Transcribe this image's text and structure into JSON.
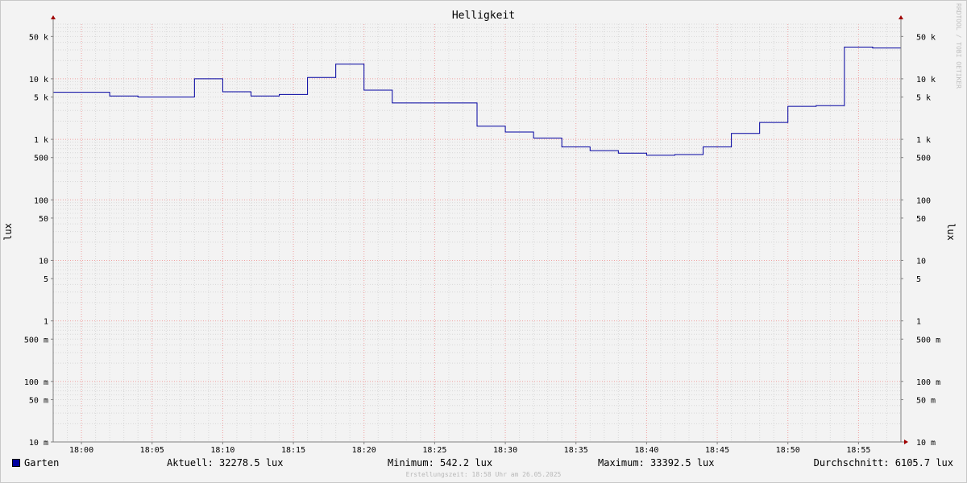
{
  "chart_data": {
    "type": "line",
    "title": "Helligkeit",
    "ylabel": "lux",
    "yscale": "log",
    "ylim": [
      0.01,
      80000
    ],
    "xlim": [
      "17:58",
      "18:58"
    ],
    "grid": true,
    "y_ticks": [
      {
        "value": 50000,
        "label": "50 k"
      },
      {
        "value": 10000,
        "label": "10 k"
      },
      {
        "value": 5000,
        "label": "5 k"
      },
      {
        "value": 1000,
        "label": "1 k"
      },
      {
        "value": 500,
        "label": "500"
      },
      {
        "value": 100,
        "label": "100"
      },
      {
        "value": 50,
        "label": "50"
      },
      {
        "value": 10,
        "label": "10"
      },
      {
        "value": 5,
        "label": "5"
      },
      {
        "value": 1,
        "label": "1"
      },
      {
        "value": 0.5,
        "label": "500 m"
      },
      {
        "value": 0.1,
        "label": "100 m"
      },
      {
        "value": 0.05,
        "label": "50 m"
      },
      {
        "value": 0.01,
        "label": "10 m"
      }
    ],
    "x_ticks": [
      "18:00",
      "18:05",
      "18:10",
      "18:15",
      "18:20",
      "18:25",
      "18:30",
      "18:35",
      "18:40",
      "18:45",
      "18:50",
      "18:55"
    ],
    "series": [
      {
        "name": "Garten",
        "color": "#0000a0",
        "step": true,
        "points": [
          {
            "x": "17:58",
            "y": 6000
          },
          {
            "x": "18:02",
            "y": 5200
          },
          {
            "x": "18:04",
            "y": 5000
          },
          {
            "x": "18:08",
            "y": 10000
          },
          {
            "x": "18:10",
            "y": 6100
          },
          {
            "x": "18:12",
            "y": 5200
          },
          {
            "x": "18:14",
            "y": 5500
          },
          {
            "x": "18:16",
            "y": 10500
          },
          {
            "x": "18:18",
            "y": 17500
          },
          {
            "x": "18:20",
            "y": 6500
          },
          {
            "x": "18:22",
            "y": 4000
          },
          {
            "x": "18:28",
            "y": 1650
          },
          {
            "x": "18:30",
            "y": 1320
          },
          {
            "x": "18:32",
            "y": 1050
          },
          {
            "x": "18:34",
            "y": 750
          },
          {
            "x": "18:36",
            "y": 650
          },
          {
            "x": "18:38",
            "y": 590
          },
          {
            "x": "18:40",
            "y": 545
          },
          {
            "x": "18:42",
            "y": 560
          },
          {
            "x": "18:44",
            "y": 750
          },
          {
            "x": "18:46",
            "y": 1250
          },
          {
            "x": "18:48",
            "y": 1900
          },
          {
            "x": "18:50",
            "y": 3500
          },
          {
            "x": "18:52",
            "y": 3600
          },
          {
            "x": "18:54",
            "y": 33400
          },
          {
            "x": "18:56",
            "y": 32278.5
          }
        ]
      }
    ]
  },
  "legend": {
    "name": "Garten",
    "current": "Aktuell: 32278.5 lux",
    "minimum": "Minimum: 542.2 lux",
    "maximum": "Maximum: 33392.5 lux",
    "average": "Durchschnitt: 6105.7 lux"
  },
  "footer": "Erstellungszeit: 18:58 Uhr am 26.05.2025",
  "watermark": "RRDTOOL / TOBI OETIKER"
}
